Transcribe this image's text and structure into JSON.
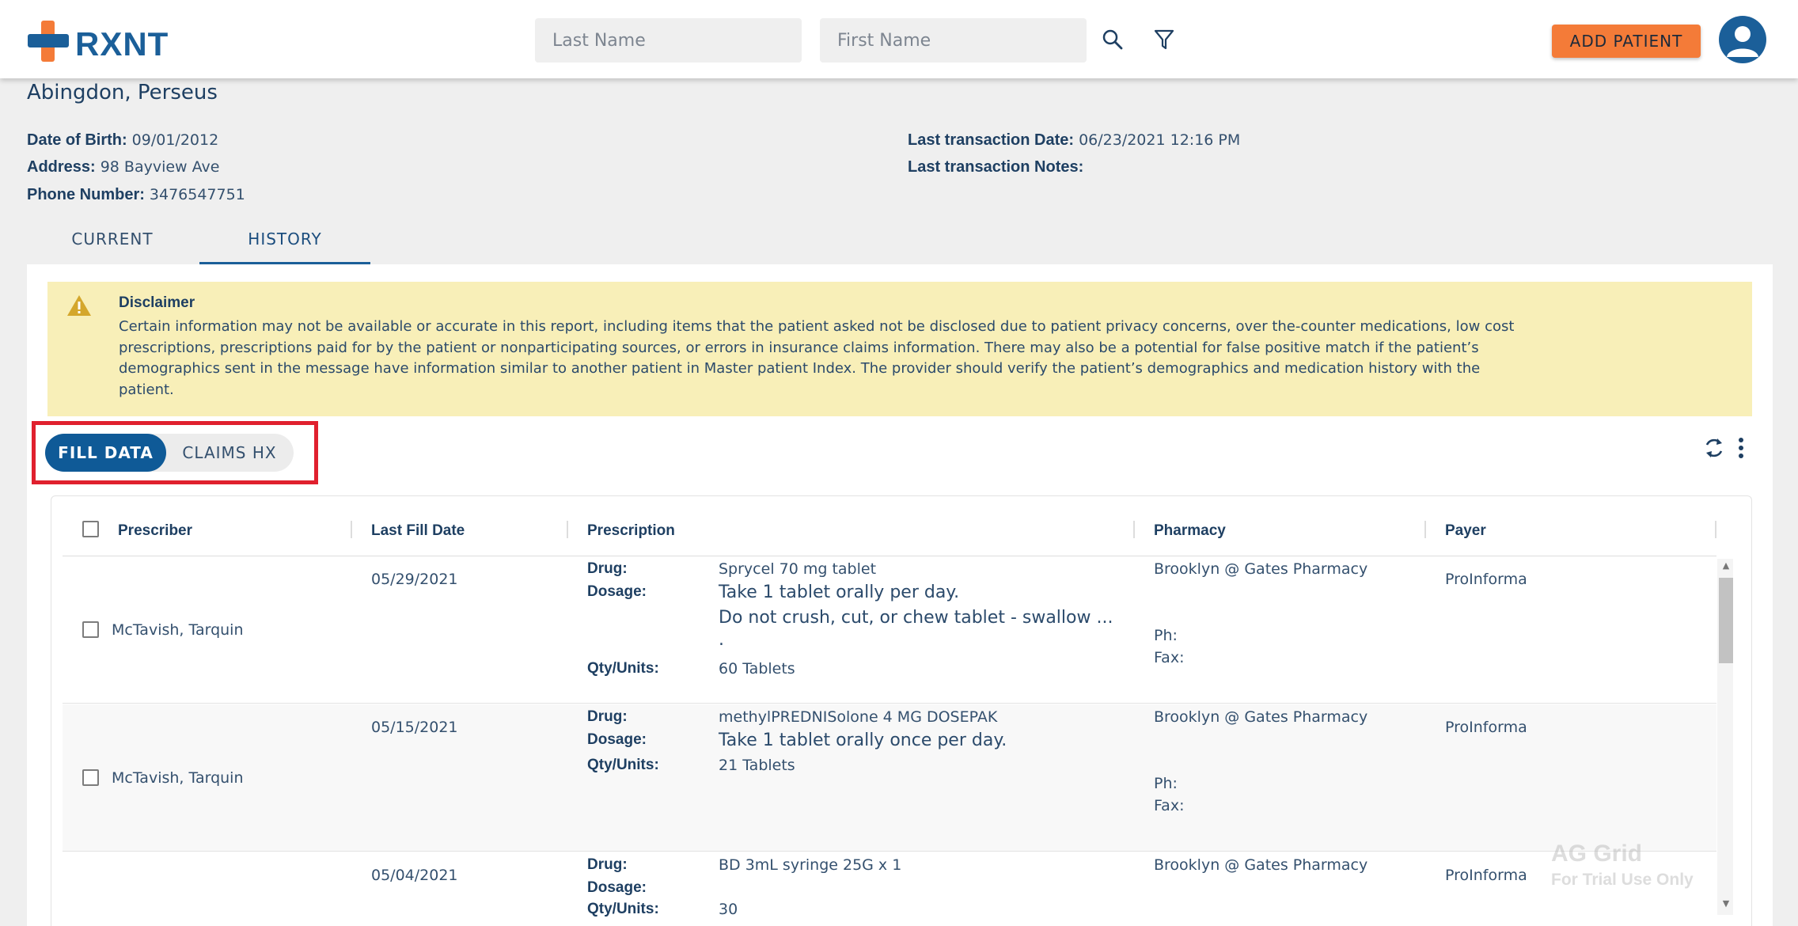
{
  "app": {
    "logo_text": "RXNT"
  },
  "search": {
    "last_name_placeholder": "Last Name",
    "first_name_placeholder": "First Name"
  },
  "header": {
    "add_patient_label": "ADD PATIENT"
  },
  "patient": {
    "name": "Abingdon, Perseus",
    "dob_label": "Date of Birth:",
    "dob": "09/01/2012",
    "address_label": "Address:",
    "address": "98 Bayview Ave",
    "phone_label": "Phone Number:",
    "phone": "3476547751",
    "last_txn_date_label": "Last transaction Date:",
    "last_txn_date": "06/23/2021 12:16 PM",
    "last_txn_notes_label": "Last transaction Notes:",
    "last_txn_notes": ""
  },
  "tabs": [
    {
      "label": "CURRENT"
    },
    {
      "label": "HISTORY"
    }
  ],
  "disclaimer": {
    "title": "Disclaimer",
    "text": "Certain information may not be available or accurate in this report, including items that the patient asked not be disclosed due to patient privacy concerns, over the-counter medications, low cost prescriptions, prescriptions paid for by the patient or nonparticipating sources, or errors in insurance claims information. There may also be a potential for false positive match if the patient’s demographics sent in the message have information similar to another patient in Master patient Index. The provider should verify the patient’s demographics and medication history with the patient."
  },
  "toggle": {
    "fill_data_label": "FILL DATA",
    "claims_hx_label": "CLAIMS HX"
  },
  "grid": {
    "columns": [
      "Prescriber",
      "Last Fill Date",
      "Prescription",
      "Pharmacy",
      "Payer"
    ],
    "labels": {
      "drug": "Drug:",
      "dosage": "Dosage:",
      "qty": "Qty/Units:",
      "ph": "Ph:",
      "fax": "Fax:"
    },
    "rows": [
      {
        "prescriber": "McTavish, Tarquin",
        "last_fill_date": "05/29/2021",
        "drug": "Sprycel 70 mg tablet",
        "dosage_line1": "Take 1 tablet orally per day.",
        "dosage_line2": "Do not crush, cut, or chew tablet - swallow ...",
        "dosage_line3": ".",
        "qty": "60 Tablets",
        "pharmacy": "Brooklyn @ Gates Pharmacy",
        "payer": "ProInforma"
      },
      {
        "prescriber": "McTavish, Tarquin",
        "last_fill_date": "05/15/2021",
        "drug": "methylPREDNISolone 4 MG DOSEPAK",
        "dosage_line1": "Take 1 tablet orally once per day.",
        "qty": "21 Tablets",
        "pharmacy": "Brooklyn @ Gates Pharmacy",
        "payer": "ProInforma"
      },
      {
        "prescriber": "",
        "last_fill_date": "05/04/2021",
        "drug": "BD 3mL syringe 25G x 1",
        "qty": "30",
        "pharmacy": "Brooklyn @ Gates Pharmacy",
        "payer": "ProInforma"
      }
    ]
  },
  "watermark": {
    "line1": "AG Grid",
    "line2": "For Trial Use Only"
  },
  "colors": {
    "brand_blue": "#1b5f99",
    "brand_orange": "#f47b38",
    "highlight_red": "#e0202e",
    "disclaimer_bg": "#f8efb8"
  }
}
